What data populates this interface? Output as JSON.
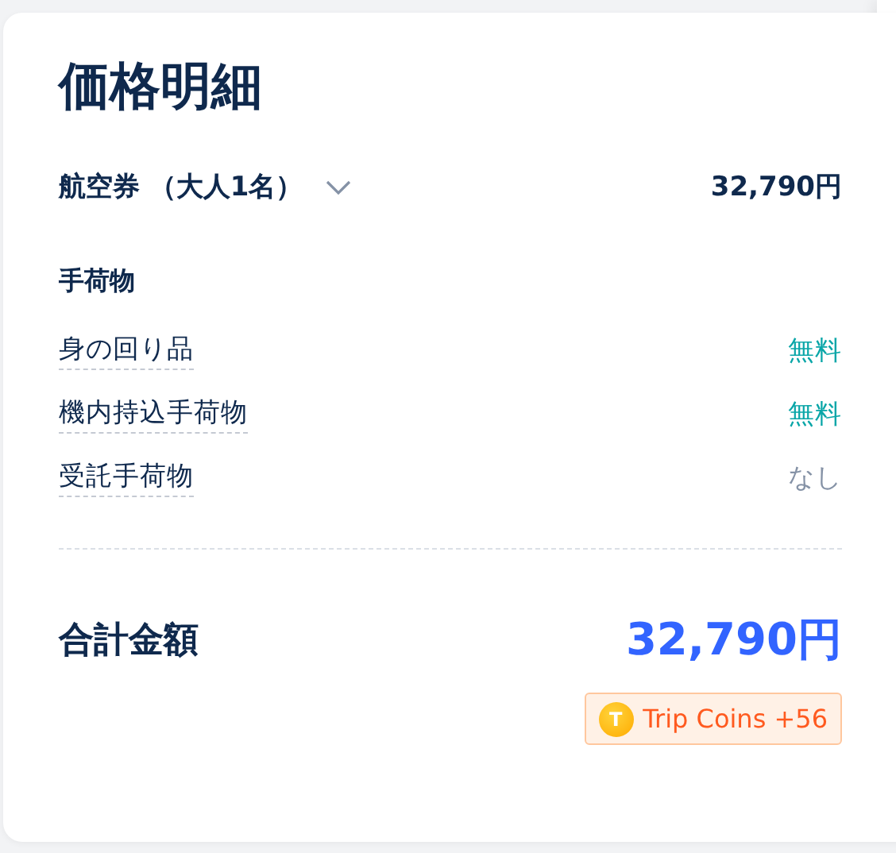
{
  "title": "価格明細",
  "fare": {
    "label": "航空券 （大人1名）",
    "expanded": false,
    "amount": "32,790円"
  },
  "baggage": {
    "heading": "手荷物",
    "items": [
      {
        "label": "身の回り品",
        "value": "無料",
        "kind": "free"
      },
      {
        "label": "機内持込手荷物",
        "value": "無料",
        "kind": "free"
      },
      {
        "label": "受託手荷物",
        "value": "なし",
        "kind": "none"
      }
    ]
  },
  "total": {
    "label": "合計金額",
    "amount": "32,790円"
  },
  "coins": {
    "coin_letter": "T",
    "text": "Trip Coins +56"
  }
}
